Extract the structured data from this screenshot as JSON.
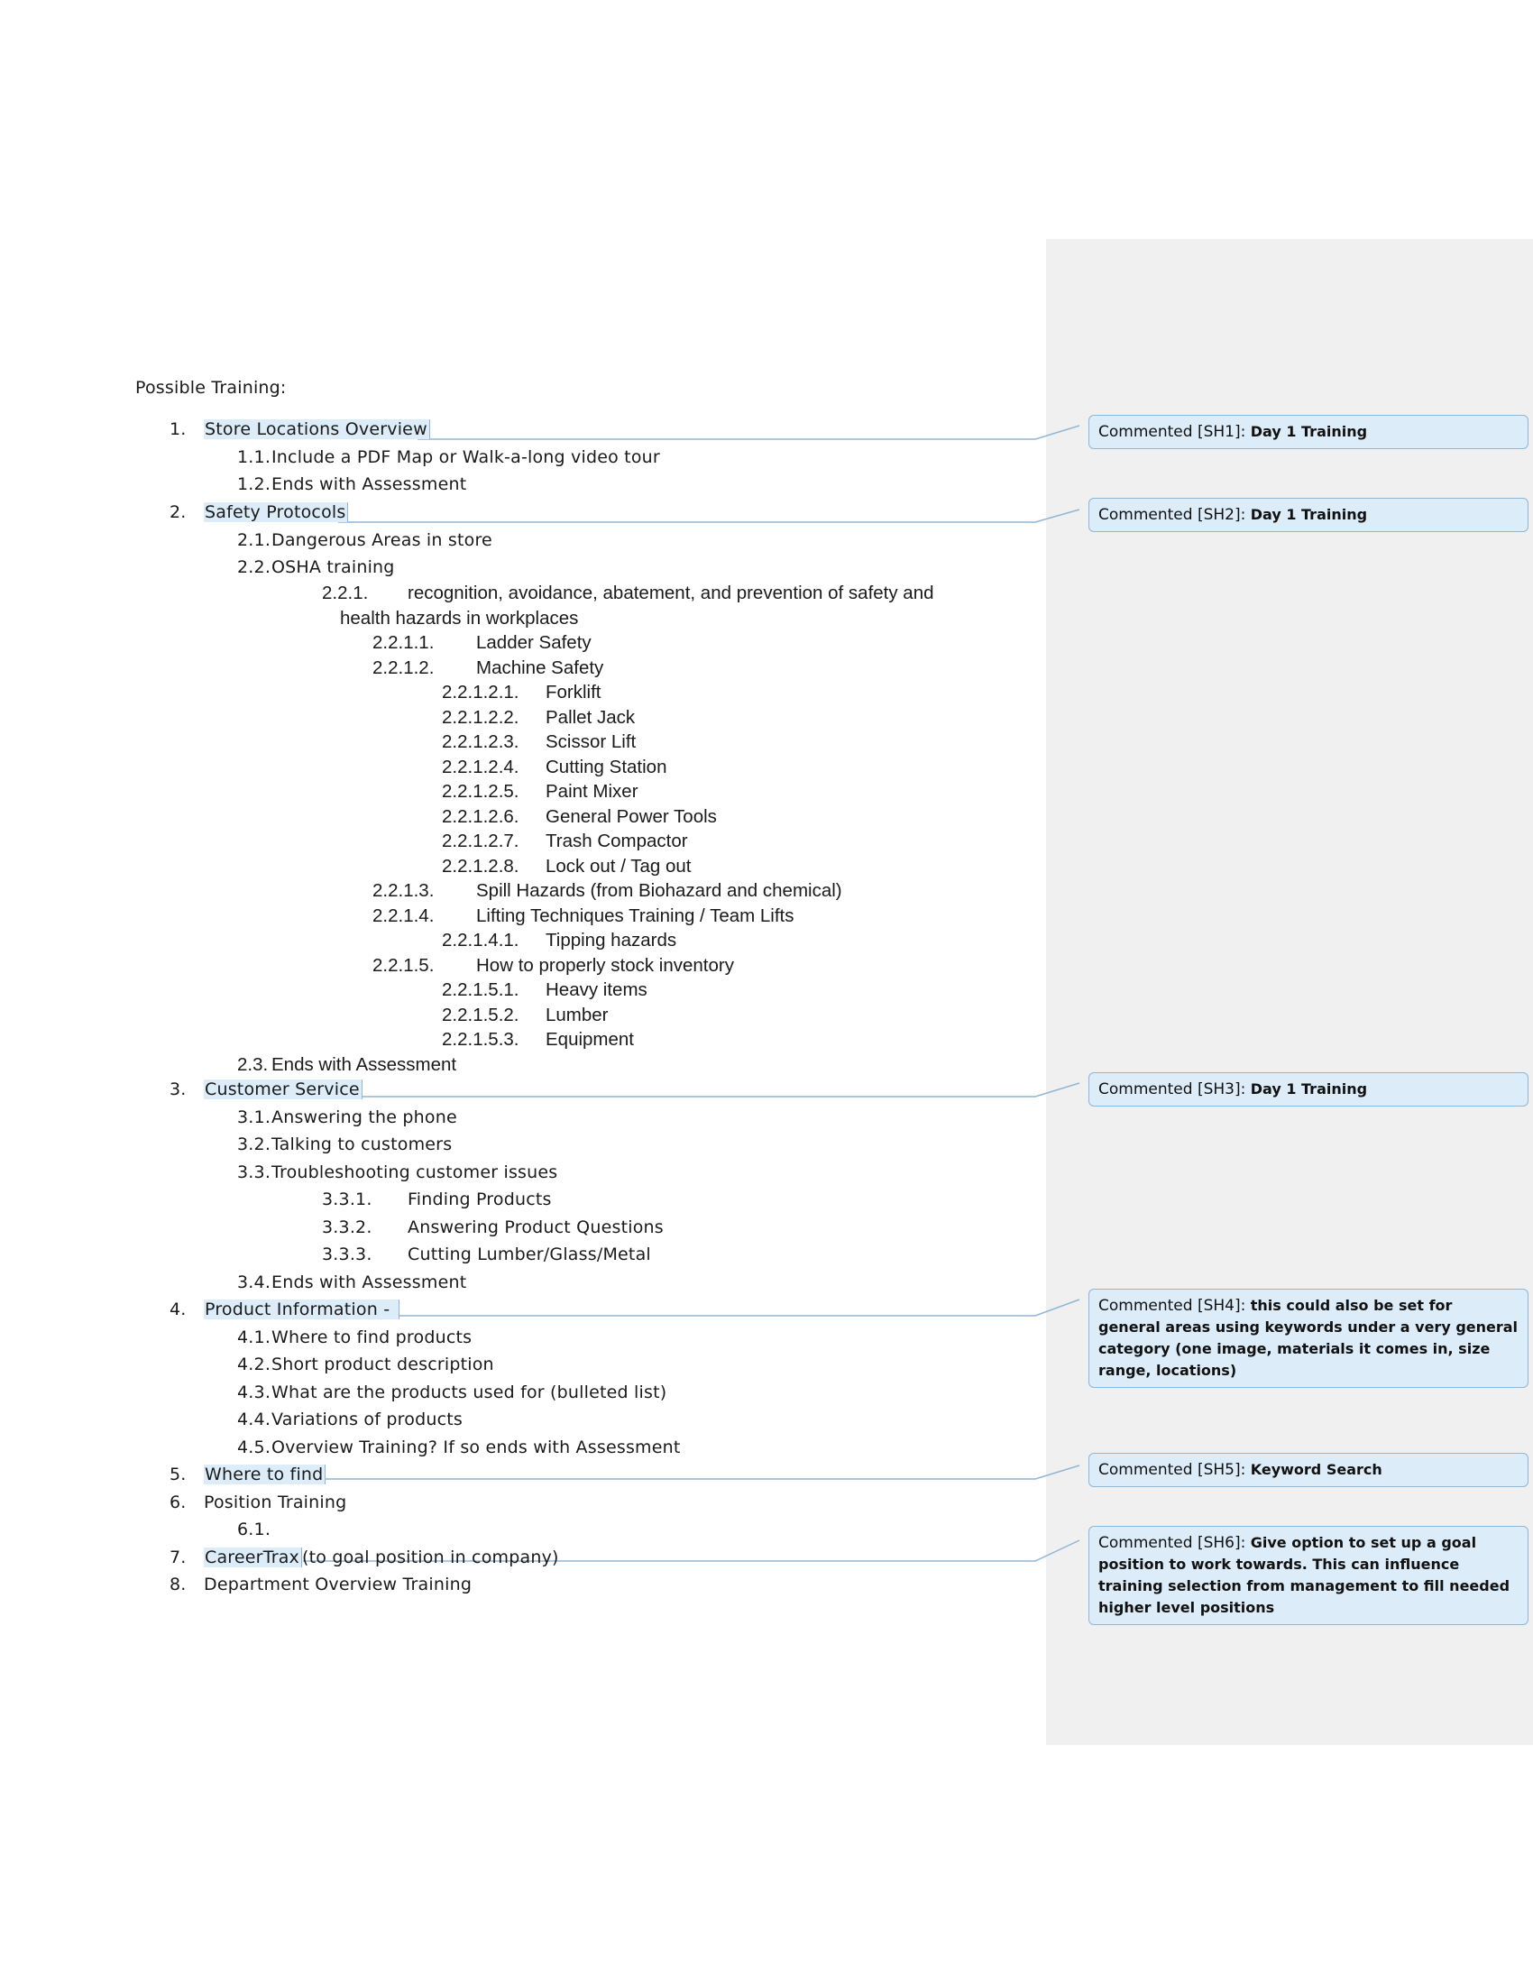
{
  "heading": "Possible Training:",
  "items": {
    "i1": {
      "num": "1.",
      "label": "Store Locations Overview"
    },
    "i1_1": {
      "num": "1.1.",
      "label": "Include a PDF Map or Walk-a-long video tour"
    },
    "i1_2": {
      "num": "1.2.",
      "label": "Ends with Assessment"
    },
    "i2": {
      "num": "2.",
      "label": "Safety Protocols"
    },
    "i2_1": {
      "num": "2.1.",
      "label": "Dangerous Areas in store"
    },
    "i2_2": {
      "num": "2.2.",
      "label": "OSHA training"
    },
    "i2_2_1": {
      "num": "2.2.1.",
      "label": "recognition, avoidance, abatement, and prevention of safety and",
      "label_cont": "health hazards in workplaces"
    },
    "i2_2_1_1": {
      "num": "2.2.1.1.",
      "label": "Ladder Safety"
    },
    "i2_2_1_2": {
      "num": "2.2.1.2.",
      "label": "Machine Safety"
    },
    "i2_2_1_2_1": {
      "num": "2.2.1.2.1.",
      "label": "Forklift"
    },
    "i2_2_1_2_2": {
      "num": "2.2.1.2.2.",
      "label": "Pallet Jack"
    },
    "i2_2_1_2_3": {
      "num": "2.2.1.2.3.",
      "label": "Scissor Lift"
    },
    "i2_2_1_2_4": {
      "num": "2.2.1.2.4.",
      "label": "Cutting Station"
    },
    "i2_2_1_2_5": {
      "num": "2.2.1.2.5.",
      "label": "Paint Mixer"
    },
    "i2_2_1_2_6": {
      "num": "2.2.1.2.6.",
      "label": "General Power Tools"
    },
    "i2_2_1_2_7": {
      "num": "2.2.1.2.7.",
      "label": "Trash Compactor"
    },
    "i2_2_1_2_8": {
      "num": "2.2.1.2.8.",
      "label": "Lock out / Tag out"
    },
    "i2_2_1_3": {
      "num": "2.2.1.3.",
      "label": "Spill Hazards (from Biohazard and chemical)"
    },
    "i2_2_1_4": {
      "num": "2.2.1.4.",
      "label": "Lifting Techniques Training / Team Lifts"
    },
    "i2_2_1_4_1": {
      "num": "2.2.1.4.1.",
      "label": "Tipping hazards"
    },
    "i2_2_1_5": {
      "num": "2.2.1.5.",
      "label": "How to properly stock inventory"
    },
    "i2_2_1_5_1": {
      "num": "2.2.1.5.1.",
      "label": "Heavy items"
    },
    "i2_2_1_5_2": {
      "num": "2.2.1.5.2.",
      "label": "Lumber"
    },
    "i2_2_1_5_3": {
      "num": "2.2.1.5.3.",
      "label": "Equipment"
    },
    "i2_3": {
      "num": "2.3.",
      "label": "Ends with Assessment"
    },
    "i3": {
      "num": "3.",
      "label": "Customer Service"
    },
    "i3_1": {
      "num": "3.1.",
      "label": "Answering the phone"
    },
    "i3_2": {
      "num": "3.2.",
      "label": "Talking to customers"
    },
    "i3_3": {
      "num": "3.3.",
      "label": "Troubleshooting customer issues"
    },
    "i3_3_1": {
      "num": "3.3.1.",
      "label": "Finding Products"
    },
    "i3_3_2": {
      "num": "3.3.2.",
      "label": "Answering Product Questions"
    },
    "i3_3_3": {
      "num": "3.3.3.",
      "label": "Cutting Lumber/Glass/Metal"
    },
    "i3_4": {
      "num": "3.4.",
      "label": "Ends with Assessment"
    },
    "i4": {
      "num": "4.",
      "label": "Product Information -"
    },
    "i4_1": {
      "num": "4.1.",
      "label": "Where to find products"
    },
    "i4_2": {
      "num": "4.2.",
      "label": "Short product description"
    },
    "i4_3": {
      "num": "4.3.",
      "label": "What are the products used for (bulleted list)"
    },
    "i4_4": {
      "num": "4.4.",
      "label": "Variations of products"
    },
    "i4_5": {
      "num": "4.5.",
      "label": "Overview Training? If so ends with Assessment"
    },
    "i5": {
      "num": "5.",
      "label": "Where to find"
    },
    "i6": {
      "num": "6.",
      "label": "Position Training"
    },
    "i6_1": {
      "num": "6.1.",
      "label": ""
    },
    "i7": {
      "num": "7.",
      "label": "CareerTrax",
      "label_rest": "(to goal position in company)"
    },
    "i8": {
      "num": "8.",
      "label": "Department Overview Training"
    }
  },
  "comments": [
    {
      "who": "Commented [SH1]:",
      "text": "Day 1 Training"
    },
    {
      "who": "Commented [SH2]:",
      "text": "Day 1 Training"
    },
    {
      "who": "Commented [SH3]:",
      "text": "Day 1 Training"
    },
    {
      "who": "Commented [SH4]:",
      "text": "this could also be set for general areas using keywords under a very general category (one image, materials it comes in, size range, locations)"
    },
    {
      "who": "Commented [SH5]:",
      "text": "Keyword Search"
    },
    {
      "who": "Commented [SH6]:",
      "text": "Give option to set up a goal position to work towards. This can influence training selection from management to fill needed higher level positions"
    }
  ],
  "colors": {
    "highlight": "#dcecf8",
    "highlight_border": "#8fb6d6",
    "pane": "#f0f0f0"
  }
}
